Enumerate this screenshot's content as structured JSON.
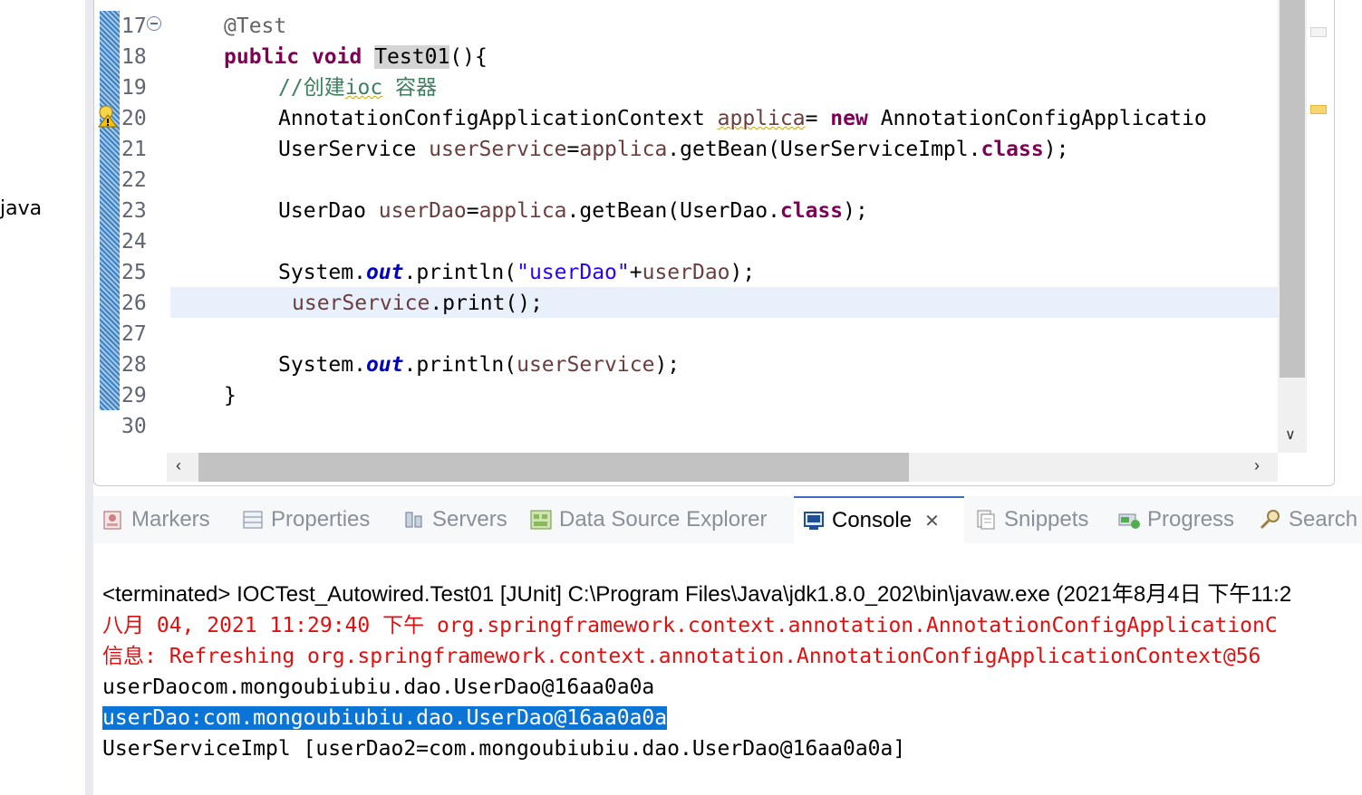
{
  "left_fragment": "java",
  "editor": {
    "line_numbers": [
      "17",
      "18",
      "19",
      "20",
      "21",
      "22",
      "23",
      "24",
      "25",
      "26",
      "27",
      "28",
      "29",
      "30"
    ],
    "code": {
      "l17_annotation": "@Test",
      "l18_public": "public",
      "l18_void": "void",
      "l18_method": "Test01",
      "l18_tail": "(){",
      "l19_comment_a": "//创建",
      "l19_comment_b": "ioc",
      "l19_comment_c": " 容器",
      "l20_type": "AnnotationConfigApplicationContext ",
      "l20_var": "applica",
      "l20_eq": "= ",
      "l20_new": "new",
      "l20_rest": " AnnotationConfigApplicatio",
      "l21_type": "UserService ",
      "l21_var": "userService",
      "l21_eq": "=",
      "l21_ref": "applica",
      "l21_mid": ".getBean(UserServiceImpl.",
      "l21_class": "class",
      "l21_end": ");",
      "l23_type": "UserDao ",
      "l23_var": "userDao",
      "l23_eq": "=",
      "l23_ref": "applica",
      "l23_mid": ".getBean(UserDao.",
      "l23_class": "class",
      "l23_end": ");",
      "l25_sys": "System.",
      "l25_out": "out",
      "l25_mid": ".println(",
      "l25_str": "\"userDao\"",
      "l25_plus": "+",
      "l25_var": "userDao",
      "l25_end": ");",
      "l26_var": "userService",
      "l26_rest": ".print();",
      "l28_sys": "System.",
      "l28_out": "out",
      "l28_mid": ".println(",
      "l28_var": "userService",
      "l28_end": ");",
      "l29_brace": "}"
    }
  },
  "tabs": [
    {
      "label": "Markers",
      "icon": "markers-icon"
    },
    {
      "label": "Properties",
      "icon": "properties-icon"
    },
    {
      "label": "Servers",
      "icon": "servers-icon"
    },
    {
      "label": "Data Source Explorer",
      "icon": "data-source-icon"
    },
    {
      "label": "Console",
      "icon": "console-icon",
      "active": true
    },
    {
      "label": "Snippets",
      "icon": "snippets-icon"
    },
    {
      "label": "Progress",
      "icon": "progress-icon"
    },
    {
      "label": "Search",
      "icon": "search-icon"
    }
  ],
  "console": {
    "header": "<terminated> IOCTest_Autowired.Test01 [JUnit] C:\\Program Files\\Java\\jdk1.8.0_202\\bin\\javaw.exe (2021年8月4日 下午11:2",
    "log1": "八月 04, 2021 11:29:40 下午 org.springframework.context.annotation.AnnotationConfigApplicationC",
    "log2": "信息: Refreshing org.springframework.context.annotation.AnnotationConfigApplicationContext@56",
    "out1": "userDaocom.mongoubiubiu.dao.UserDao@16aa0a0a",
    "out2": "userDao:com.mongoubiubiu.dao.UserDao@16aa0a0a",
    "out3": "UserServiceImpl [userDao2=com.mongoubiubiu.dao.UserDao@16aa0a0a]"
  },
  "colors": {
    "keyword": "#7f0055",
    "comment": "#3f7f5f",
    "local_var": "#6a3e3e",
    "string": "#2a00ff",
    "static_field": "#0000c0",
    "error_log": "#e01010",
    "selection": "#0b74d7"
  }
}
